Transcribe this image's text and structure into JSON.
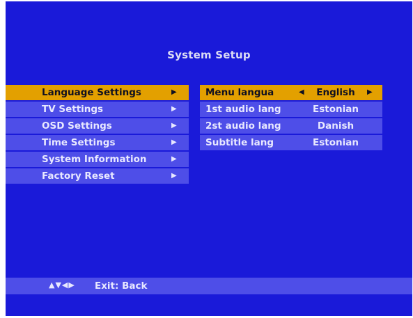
{
  "title": "System Setup",
  "menu": {
    "items": [
      {
        "label": "Language Settings",
        "arrow": "▶",
        "selected": true
      },
      {
        "label": "TV Settings",
        "arrow": "▶"
      },
      {
        "label": "OSD Settings",
        "arrow": "▶"
      },
      {
        "label": "Time Settings",
        "arrow": "▶"
      },
      {
        "label": "System Information",
        "arrow": "▶"
      },
      {
        "label": "Factory Reset",
        "arrow": "▶"
      }
    ]
  },
  "language_panel": {
    "rows": [
      {
        "label": "Menu langua",
        "value": "English",
        "left_arrow": "◀",
        "right_arrow": "▶",
        "selected": true
      },
      {
        "label": "1st audio lang",
        "value": "Estonian"
      },
      {
        "label": "2st audio lang",
        "value": "Danish"
      },
      {
        "label": "Subtitle lang",
        "value": "Estonian"
      }
    ]
  },
  "footer": {
    "nav_icons": "▲▼◀▶",
    "hint": "Exit: Back"
  },
  "colors": {
    "background": "#1a1ad9",
    "row": "#4e4ee8",
    "highlight": "#e3a000"
  }
}
